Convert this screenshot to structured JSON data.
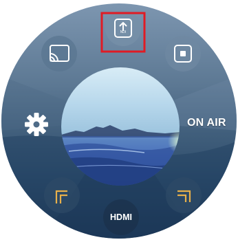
{
  "dial": {
    "on_air_label": "ON AIR",
    "hdmi_label": "HDMI",
    "ndi_label": "NDI"
  },
  "icons": {
    "ndi_upload": "ndi-upload-icon",
    "cast": "cast-icon",
    "record": "record-icon",
    "settings": "gear-icon",
    "frame_top_left": "frame-corner-icon",
    "frame_bottom_right": "frame-corner-icon"
  },
  "colors": {
    "highlight": "#e01b24",
    "accent": "#e8b04a",
    "ring": "#5a7590"
  }
}
